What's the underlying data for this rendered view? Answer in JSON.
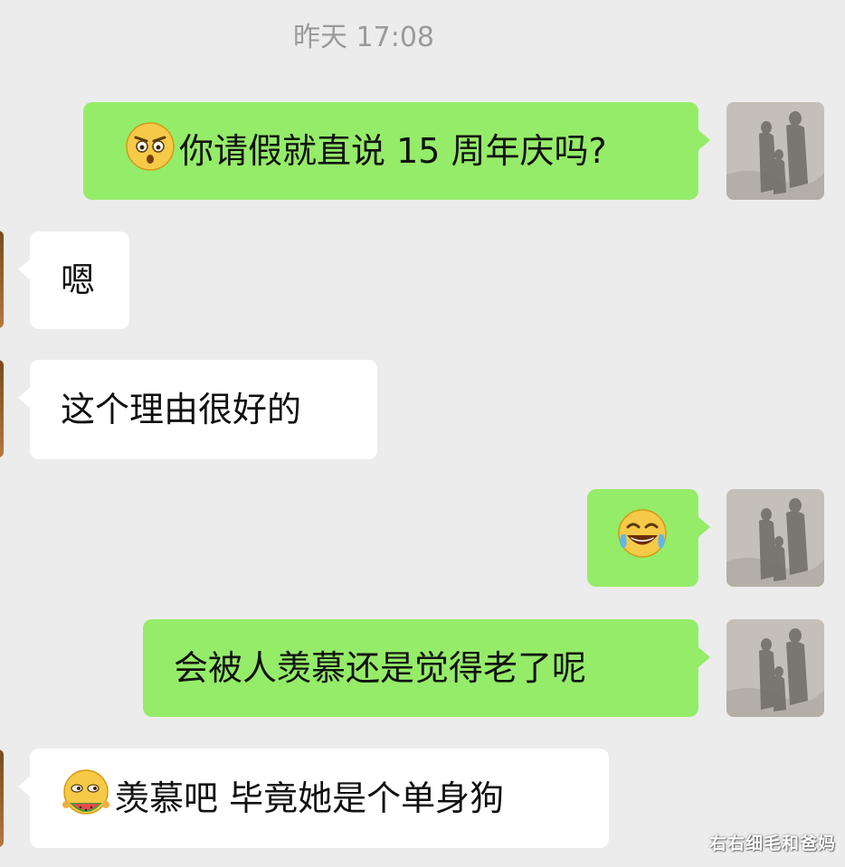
{
  "chat": {
    "timestamp": "昨天 17:08",
    "messages": [
      {
        "side": "out",
        "emoji": "shocked-face-emoji",
        "text": "你请假就直说 15 周年庆吗?"
      },
      {
        "side": "in",
        "text": "嗯"
      },
      {
        "side": "in",
        "text": "这个理由很好的"
      },
      {
        "side": "out",
        "emoji": "tears-of-joy-emoji",
        "text": ""
      },
      {
        "side": "out",
        "text": "会被人羡慕还是觉得老了呢"
      },
      {
        "side": "in",
        "emoji": "eating-watermelon-emoji",
        "text": "羡慕吧 毕竟她是个单身狗"
      }
    ]
  },
  "watermark": "右右细毛和爸妈",
  "colors": {
    "background": "#ececec",
    "outgoing_bubble": "#95ec69",
    "incoming_bubble": "#ffffff",
    "timestamp_text": "#9a9a9a"
  }
}
